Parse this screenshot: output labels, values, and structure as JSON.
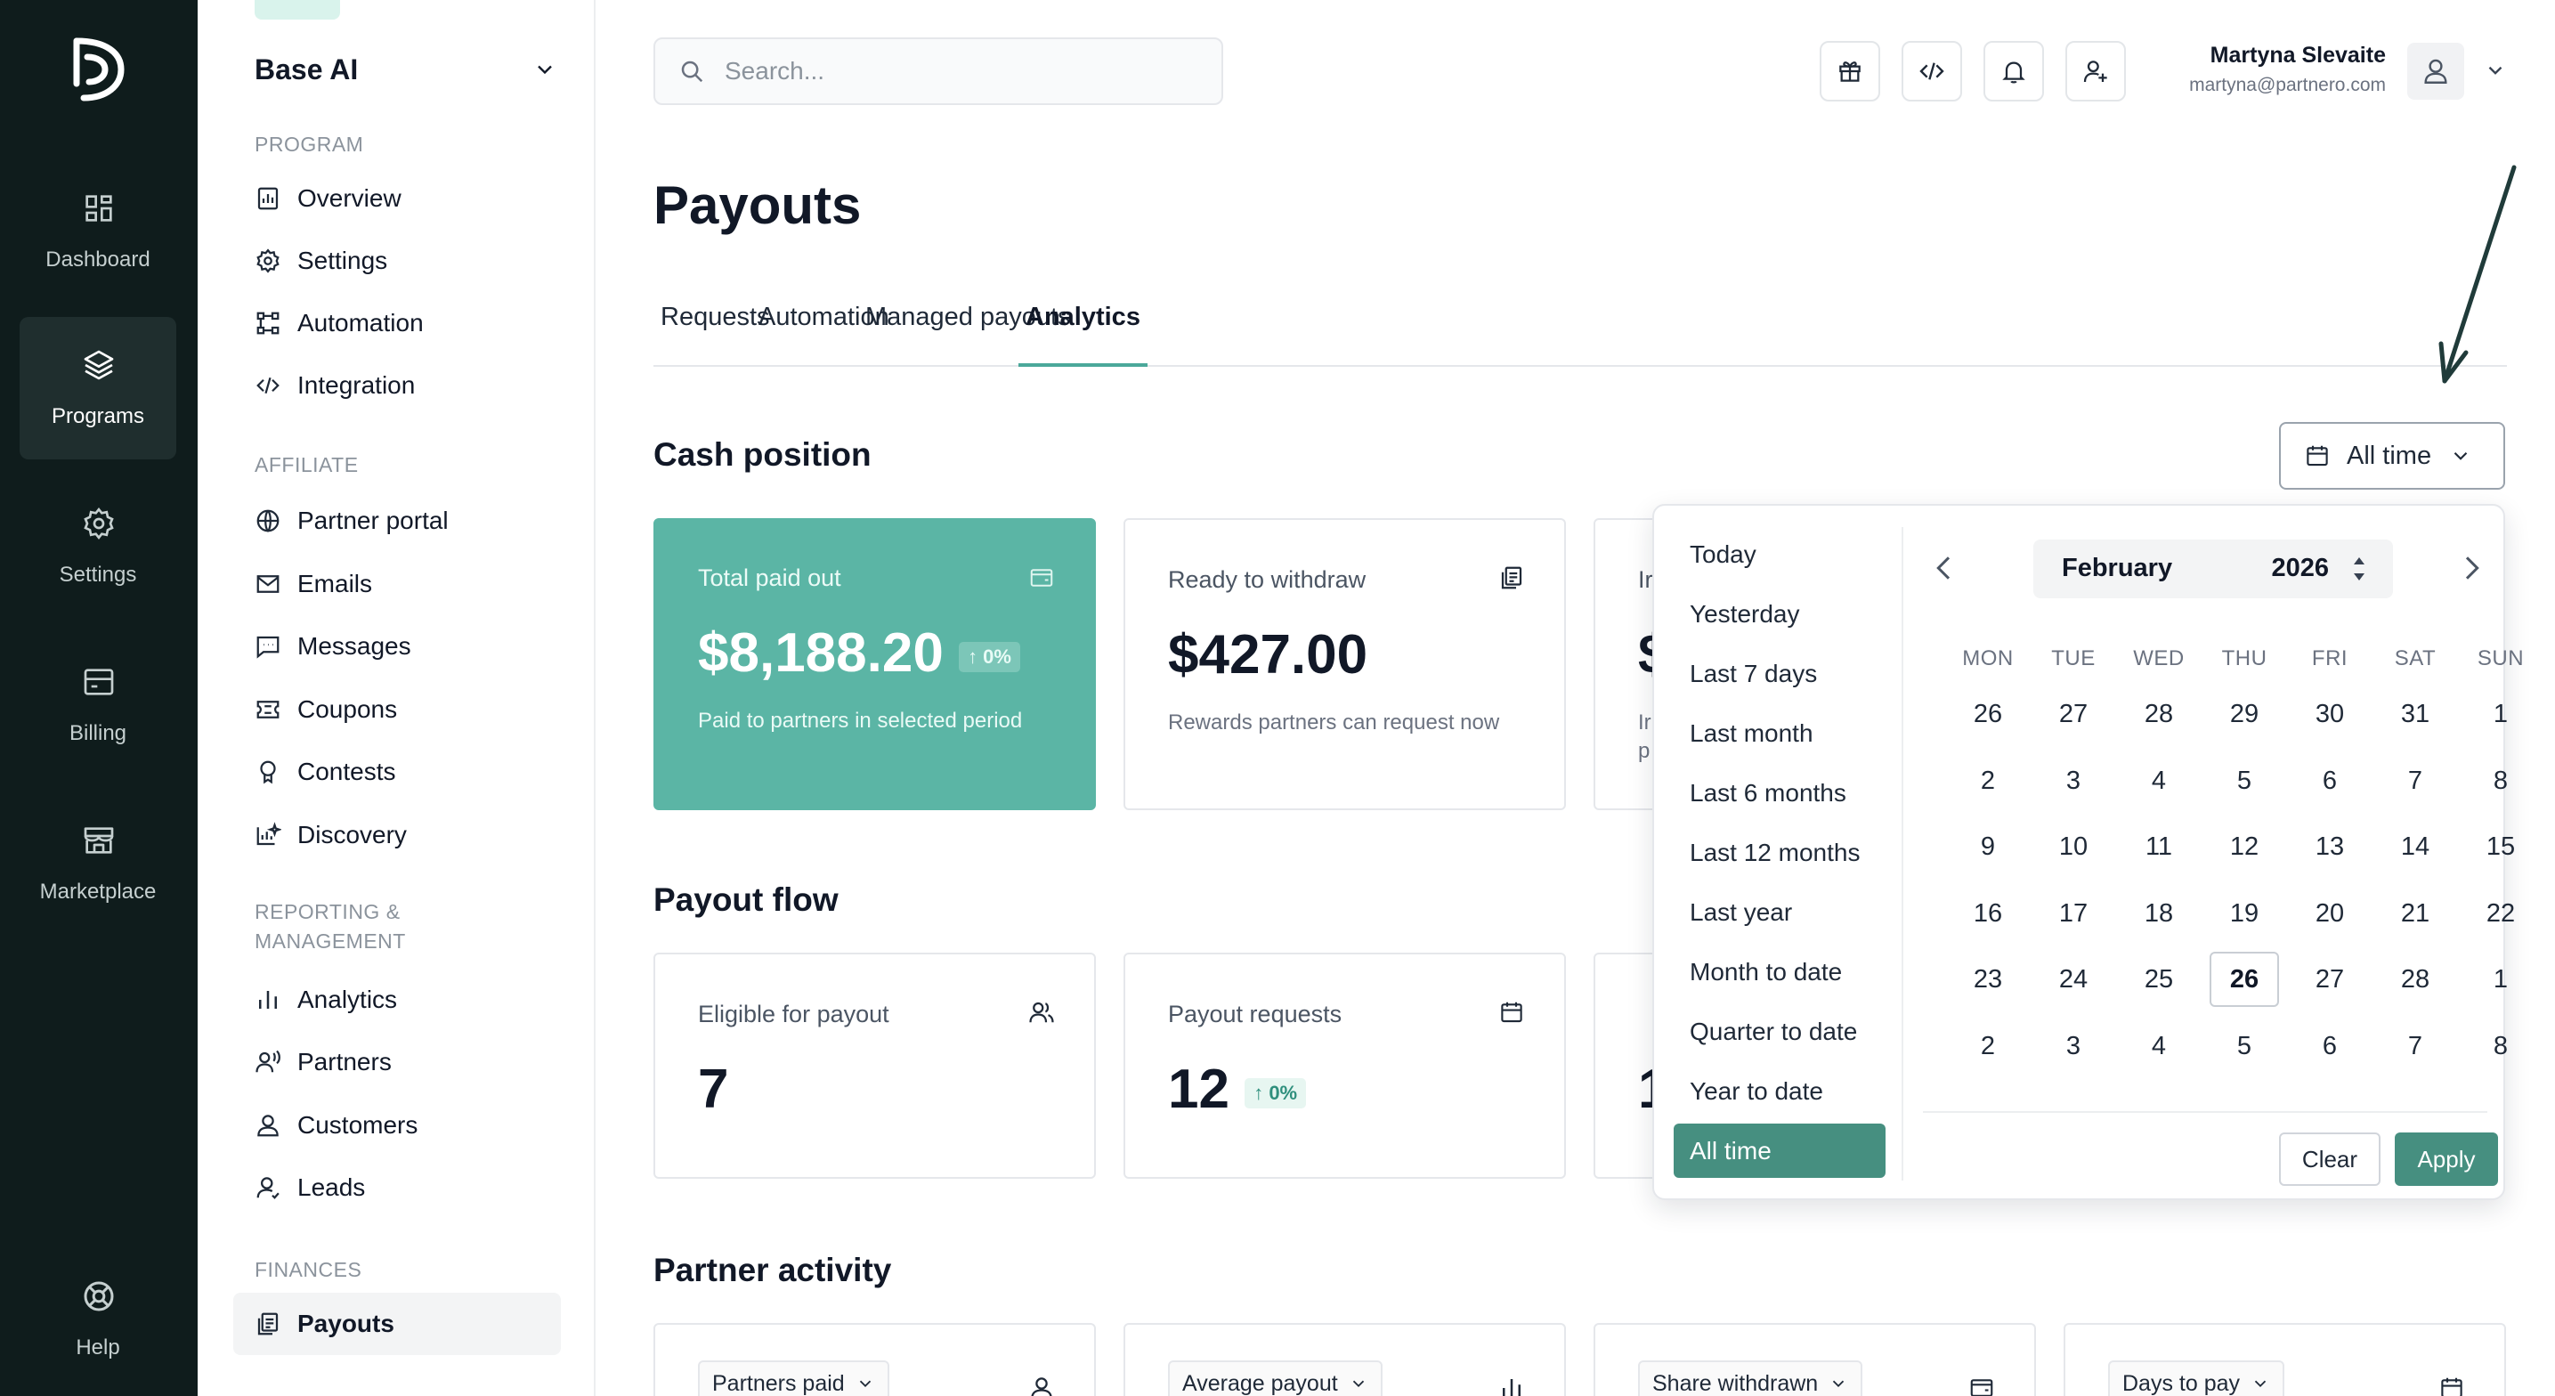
{
  "rail": {
    "items": [
      {
        "label": "Dashboard",
        "icon": "dashboard-icon"
      },
      {
        "label": "Programs",
        "icon": "layers-icon"
      },
      {
        "label": "Settings",
        "icon": "gear-icon"
      },
      {
        "label": "Billing",
        "icon": "billing-icon"
      },
      {
        "label": "Marketplace",
        "icon": "store-icon"
      },
      {
        "label": "Help",
        "icon": "lifebuoy-icon"
      }
    ]
  },
  "nav": {
    "org_name": "Base AI",
    "sections": {
      "program": "PROGRAM",
      "affiliate": "AFFILIATE",
      "reporting_line1": "REPORTING &",
      "reporting_line2": "MANAGEMENT",
      "finances": "FINANCES"
    },
    "items": {
      "overview": "Overview",
      "settings": "Settings",
      "automation": "Automation",
      "integration": "Integration",
      "partner_portal": "Partner portal",
      "emails": "Emails",
      "messages": "Messages",
      "coupons": "Coupons",
      "contests": "Contests",
      "discovery": "Discovery",
      "analytics": "Analytics",
      "partners": "Partners",
      "customers": "Customers",
      "leads": "Leads",
      "payouts": "Payouts"
    }
  },
  "header": {
    "search_placeholder": "Search...",
    "user_name": "Martyna Slevaite",
    "user_email": "martyna@partnero.com",
    "icons": [
      "gift-icon",
      "code-icon",
      "bell-icon",
      "user-plus-icon"
    ]
  },
  "page": {
    "title": "Payouts",
    "tabs": [
      "Requests",
      "Automation",
      "Managed payouts",
      "Analytics"
    ],
    "active_tab": "Analytics"
  },
  "cash_position": {
    "title": "Cash position",
    "range_label": "All time",
    "cards": [
      {
        "label": "Total paid out",
        "value": "$8,188.20",
        "badge": "↑ 0%",
        "sub": "Paid to partners in selected period"
      },
      {
        "label": "Ready to withdraw",
        "value": "$427.00",
        "sub": "Rewards partners can request now"
      },
      {
        "label_clip": "Ir",
        "value_clip": "$",
        "sub_clip1": "Ir",
        "sub_clip2": "p"
      }
    ]
  },
  "payout_flow": {
    "title": "Payout flow",
    "cards": [
      {
        "label": "Eligible for payout",
        "value": "7"
      },
      {
        "label": "Payout requests",
        "value": "12",
        "badge": "↑ 0%"
      },
      {
        "value_clip": "1"
      }
    ]
  },
  "partner_activity": {
    "title": "Partner activity",
    "dropdowns": [
      "Partners paid",
      "Average payout",
      "Share withdrawn",
      "Days to pay"
    ]
  },
  "date_picker": {
    "presets": [
      "Today",
      "Yesterday",
      "Last 7 days",
      "Last month",
      "Last 6 months",
      "Last 12 months",
      "Last year",
      "Month to date",
      "Quarter to date",
      "Year to date",
      "All time"
    ],
    "active_preset": "All time",
    "month": "February",
    "year": "2026",
    "weekdays": [
      "MON",
      "TUE",
      "WED",
      "THU",
      "FRI",
      "SAT",
      "SUN"
    ],
    "weeks": [
      [
        "26",
        "27",
        "28",
        "29",
        "30",
        "31",
        "1"
      ],
      [
        "2",
        "3",
        "4",
        "5",
        "6",
        "7",
        "8"
      ],
      [
        "9",
        "10",
        "11",
        "12",
        "13",
        "14",
        "15"
      ],
      [
        "16",
        "17",
        "18",
        "19",
        "20",
        "21",
        "22"
      ],
      [
        "23",
        "24",
        "25",
        "26",
        "27",
        "28",
        "1"
      ],
      [
        "2",
        "3",
        "4",
        "5",
        "6",
        "7",
        "8"
      ]
    ],
    "today": "26",
    "clear_label": "Clear",
    "apply_label": "Apply"
  },
  "colors": {
    "rail_bg": "#0f1c1c",
    "accent": "#468f80",
    "card_green": "#5bb5a5"
  }
}
